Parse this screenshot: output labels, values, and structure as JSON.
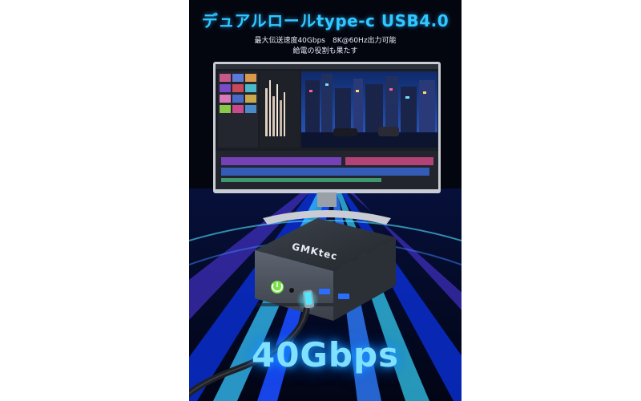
{
  "headline": "デュアルロールtype-c USB4.0",
  "subline_1": "最大伝送速度40Gbps　8K@60Hz出力可能",
  "subline_2": "給電の役割も果たす",
  "brand_logo": "GMKtec",
  "speed_label": "40Gbps",
  "colors": {
    "background": "#04060f",
    "accent_blue": "#2fc8ff",
    "light_streak_blue": "#1a4dff",
    "light_streak_cyan": "#37d6ff",
    "power_button_green": "#7be24a",
    "usb_port_blue": "#2a6dff",
    "device_body": "#2b2f36"
  },
  "icons": [
    "power-icon",
    "usb-c-cable-icon",
    "usb-a-port-icon"
  ]
}
